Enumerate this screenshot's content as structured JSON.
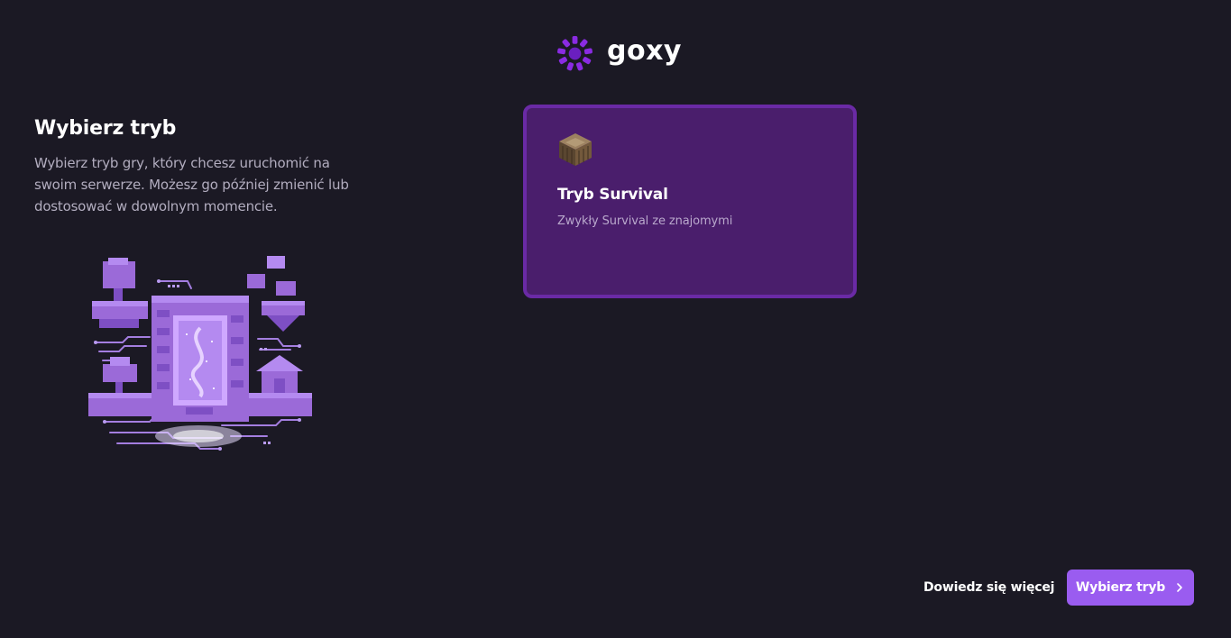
{
  "brand": {
    "name": "goxy",
    "accent": "#9a5cf0",
    "logo_icon": "goxy-ring-icon"
  },
  "intro": {
    "title": "Wybierz tryb",
    "description": "Wybierz tryb gry, który chcesz uruchomić na swoim serwerze. Możesz go później zmienić lub dostosować w dowolnym momencie."
  },
  "modes": [
    {
      "icon": "wood-block-icon",
      "title": "Tryb Survival",
      "description": "Zwykły Survival ze znajomymi",
      "selected": true
    }
  ],
  "footer": {
    "learn_more_label": "Dowiedz się więcej",
    "select_label": "Wybierz tryb",
    "select_icon": "chevron-right-icon"
  }
}
